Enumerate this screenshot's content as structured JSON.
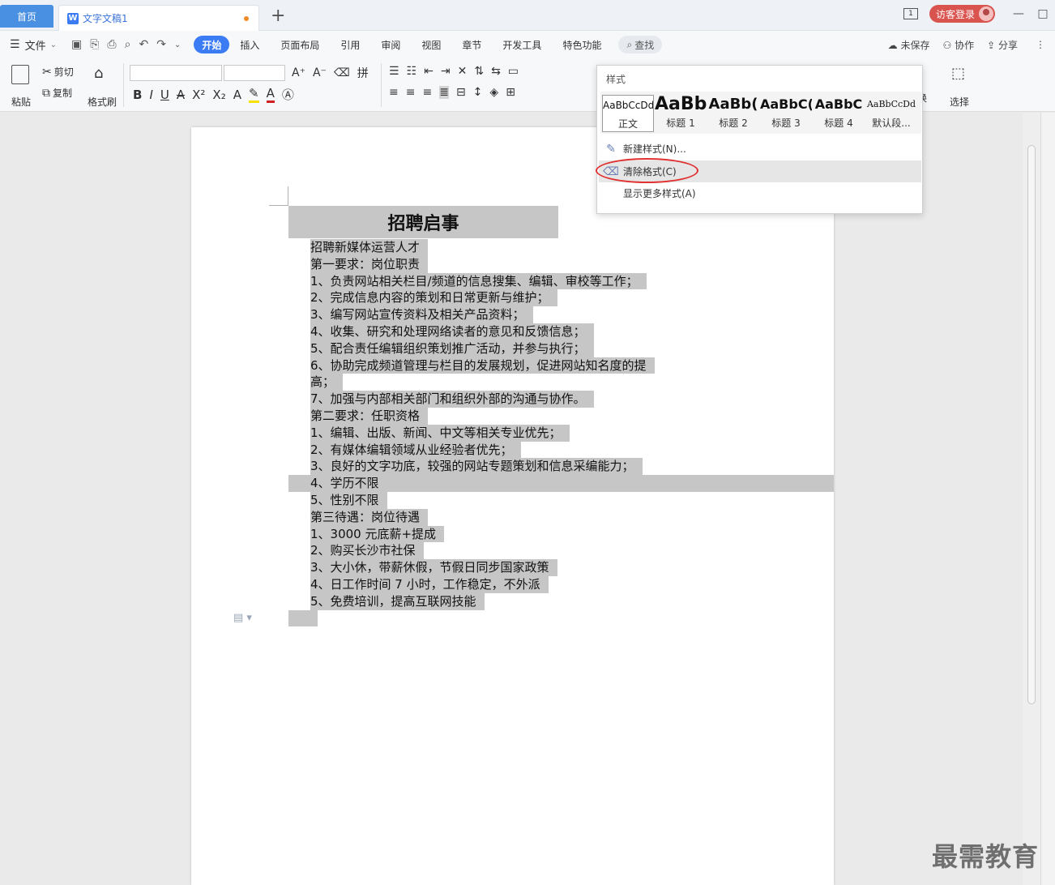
{
  "titlebar": {
    "home_tab": "首页",
    "doc_tab": "文字文稿1",
    "add_tab": "+",
    "window_count": "1",
    "login": "访客登录",
    "minimize": "—",
    "maximize": "□"
  },
  "menu": {
    "file": "文件",
    "tabs": [
      "开始",
      "插入",
      "页面布局",
      "引用",
      "审阅",
      "视图",
      "章节",
      "开发工具",
      "特色功能"
    ],
    "search": "查找",
    "right": [
      "未保存",
      "协作",
      "分享"
    ]
  },
  "ribbon": {
    "paste": "粘贴",
    "cut": "剪切",
    "copy": "复制",
    "format_painter": "格式刷",
    "replace_partial": "换",
    "select": "选择"
  },
  "styles_popup": {
    "title": "样式",
    "styles": [
      {
        "sample": "AaBbCcDd",
        "name": "正文"
      },
      {
        "sample": "AaBb",
        "name": "标题 1"
      },
      {
        "sample": "AaBb(",
        "name": "标题 2"
      },
      {
        "sample": "AaBbC(",
        "name": "标题 3"
      },
      {
        "sample": "AaBbC",
        "name": "标题 4"
      },
      {
        "sample": "AaBbCcDd",
        "name": "默认段..."
      }
    ],
    "new_style": "新建样式(N)...",
    "clear_format": "清除格式(C)",
    "more_styles": "显示更多样式(A)"
  },
  "document": {
    "title": "招聘启事",
    "lines": [
      "招聘新媒体运营人才",
      "第一要求：岗位职责",
      "1、负责网站相关栏目/频道的信息搜集、编辑、审校等工作；",
      "2、完成信息内容的策划和日常更新与维护；",
      "3、编写网站宣传资料及相关产品资料；",
      "4、收集、研究和处理网络读者的意见和反馈信息；",
      "5、配合责任编辑组织策划推广活动，并参与执行；",
      "6、协助完成频道管理与栏目的发展规划，促进网站知名度的提",
      "高；",
      "7、加强与内部相关部门和组织外部的沟通与协作。",
      "第二要求：任职资格",
      "1、编辑、出版、新闻、中文等相关专业优先；",
      "2、有媒体编辑领域从业经验者优先；",
      "3、良好的文字功底，较强的网站专题策划和信息采编能力；",
      "4、学历不限",
      "5、性别不限",
      "第三待遇：岗位待遇",
      "1、3000 元底薪+提成",
      "2、购买长沙市社保",
      "3、大小休，带薪休假，节假日同步国家政策",
      "4、日工作时间 7 小时，工作稳定，不外派",
      "5、免费培训，提高互联网技能"
    ]
  },
  "watermark": "最需教育",
  "colors": {
    "accent": "#3b7cf5",
    "selection": "#c6c6c6",
    "login": "#d9534f",
    "annotation_ring": "#e03030"
  }
}
